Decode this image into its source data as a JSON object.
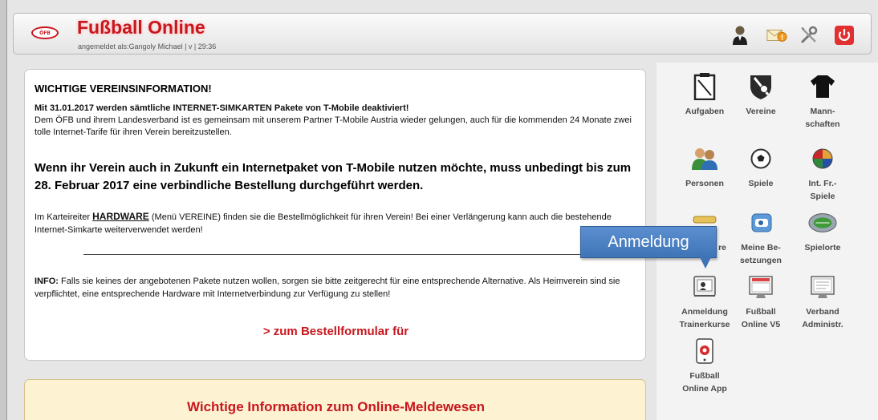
{
  "header": {
    "logo_text": "ÖFB",
    "title": "Fußball Online",
    "login_info": "angemeldet als:Gangoly Michael | v | 29:36"
  },
  "notice": {
    "heading": "WICHTIGE VEREINSINFORMATION!",
    "lead_bold": "Mit 31.01.2017 werden sämtliche INTERNET-SIMKARTEN Pakete von T-Mobile deaktiviert!",
    "lead_text": "Dem ÖFB und ihrem Landesverband ist es gemeinsam mit unserem Partner T-Mobile Austria wieder gelungen, auch für die kommenden 24 Monate zwei tolle Internet-Tarife für ihren Verein bereitzustellen.",
    "highlight": "Wenn ihr Verein auch in Zukunft ein Internetpaket von T-Mobile nutzen möchte, muss unbedingt bis zum 28. Februar 2017 eine verbindliche Bestellung durchgeführt werden.",
    "hw_prefix": "Im Karteireiter ",
    "hw_keyword": "HARDWARE",
    "hw_suffix": " (Menü VEREINE) finden sie die Bestellmöglichkeit für ihren Verein! Bei einer Verlängerung kann auch die bestehende Internet-Simkarte weiterverwendet werden!",
    "info_label": "INFO:",
    "info_text": " Falls sie keines der angebotenen Pakete nutzen wollen, sorgen sie bitte zeitgerecht für eine entsprechende Alternative. Als Heimverein sind sie verpflichtet, eine entsprechende Hardware mit Internetverbindung zur Verfügung zu stellen!",
    "order_link": "> zum Bestellformular für"
  },
  "info_panel": {
    "title": "Wichtige Information zum Online-Meldewesen"
  },
  "menu": {
    "tiles": [
      {
        "label": "Aufgaben",
        "icon": "clipboard-icon"
      },
      {
        "label": "Vereine",
        "icon": "club-crest-icon"
      },
      {
        "label": "Mann-\nschaften",
        "icon": "jersey-icon"
      },
      {
        "label": "Personen",
        "icon": "people-icon"
      },
      {
        "label": "Spiele",
        "icon": "football-icon"
      },
      {
        "label": "Int. Fr.-\nSpiele",
        "icon": "international-ball-icon"
      },
      {
        "label": "re",
        "icon": "referee-icon"
      },
      {
        "label": "Meine Be-\nsetzungen",
        "icon": "whistle-icon"
      },
      {
        "label": "Spielorte",
        "icon": "stadium-icon"
      },
      {
        "label": "Anmeldung\nTrainerkurse",
        "icon": "course-registration-icon"
      },
      {
        "label": "Fußball\nOnline V5",
        "icon": "monitor-icon"
      },
      {
        "label": "Verband\nAdministr.",
        "icon": "admin-monitor-icon"
      },
      {
        "label": "Fußball\nOnline App",
        "icon": "phone-app-icon"
      }
    ]
  },
  "tooltip": {
    "text": "Anmeldung"
  },
  "colors": {
    "brand_red": "#c8161d",
    "callout_blue": "#4a80c4",
    "notice_bg": "#fdf3d3"
  }
}
